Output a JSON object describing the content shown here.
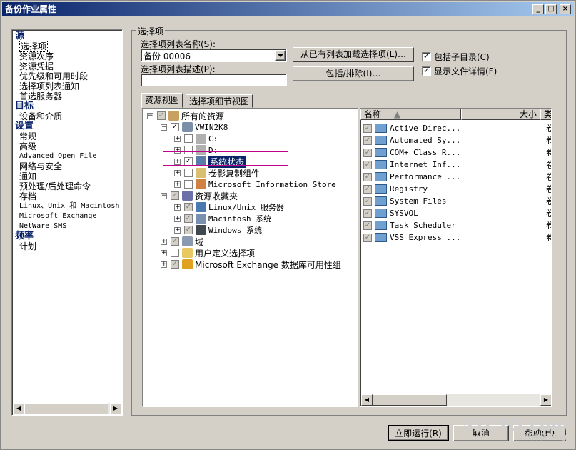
{
  "window": {
    "title": "备份作业属性",
    "controls": [
      "_",
      "□",
      "×"
    ]
  },
  "nav": {
    "items": [
      {
        "label": "源",
        "kind": "head"
      },
      {
        "label": "选择项",
        "kind": "item",
        "selected": true
      },
      {
        "label": "资源次序",
        "kind": "item"
      },
      {
        "label": "资源凭据",
        "kind": "item"
      },
      {
        "label": "优先级和可用时段",
        "kind": "item"
      },
      {
        "label": "选择项列表通知",
        "kind": "item"
      },
      {
        "label": "首选服务器",
        "kind": "item"
      },
      {
        "label": "目标",
        "kind": "head"
      },
      {
        "label": "设备和介质",
        "kind": "item"
      },
      {
        "label": "设置",
        "kind": "head"
      },
      {
        "label": "常规",
        "kind": "item"
      },
      {
        "label": "高级",
        "kind": "item"
      },
      {
        "label": "Advanced Open File",
        "kind": "item",
        "mono": true
      },
      {
        "label": "网络与安全",
        "kind": "item"
      },
      {
        "label": "通知",
        "kind": "item"
      },
      {
        "label": "预处理/后处理命令",
        "kind": "item"
      },
      {
        "label": "存档",
        "kind": "item"
      },
      {
        "label": "Linux、Unix 和 Macintosh",
        "kind": "item",
        "mono": true
      },
      {
        "label": "Microsoft Exchange",
        "kind": "item",
        "mono": true
      },
      {
        "label": "NetWare SMS",
        "kind": "item",
        "mono": true
      },
      {
        "label": "频率",
        "kind": "head"
      },
      {
        "label": "计划",
        "kind": "item"
      }
    ]
  },
  "selection": {
    "group_label": "选择项",
    "list_name_label": "选择项列表名称(S):",
    "list_name_value": "备份 00006",
    "list_desc_label": "选择项列表描述(P):",
    "list_desc_value": "",
    "load_button": "从已有列表加载选择项(L)…",
    "include_button": "包括/排除(I)…",
    "include_subdirs_label": "包括子目录(C)",
    "include_subdirs_checked": true,
    "show_details_label": "显示文件详情(F)",
    "show_details_checked": true
  },
  "tabs": [
    "资源视图",
    "选择项细节视图"
  ],
  "tree": {
    "all_resources": "所有的资源",
    "host": "VWIN2K8",
    "drive_c": "C:",
    "drive_d": "D:",
    "system_state": "系统状态",
    "shadow_copy": "卷影复制组件",
    "info_store": "Microsoft Information Store",
    "favorites": "资源收藏夹",
    "unix_servers": "Linux/Unix 服务器",
    "mac_systems": "Macintosh 系统",
    "windows_systems": "Windows 系统",
    "domains": "域",
    "user_defined": "用户定义选择项",
    "exchange_dag": "Microsoft Exchange 数据库可用性组"
  },
  "list": {
    "col_name": "名称",
    "col_size": "大小",
    "col_type": "类",
    "rows": [
      {
        "name": "Active Direc...",
        "type": "卷"
      },
      {
        "name": "Automated Sy...",
        "type": "卷"
      },
      {
        "name": "COM+ Class R...",
        "type": "卷"
      },
      {
        "name": "Internet Inf...",
        "type": "卷"
      },
      {
        "name": "Performance ...",
        "type": "卷"
      },
      {
        "name": "Registry",
        "type": "卷"
      },
      {
        "name": "System Files",
        "type": "卷"
      },
      {
        "name": "SYSVOL",
        "type": "卷"
      },
      {
        "name": "Task Scheduler",
        "type": "卷"
      },
      {
        "name": "VSS Express ...",
        "type": "卷"
      }
    ]
  },
  "footer": {
    "run_now": "立即运行(R)",
    "cancel": "取消",
    "help": "帮助(H)"
  },
  "watermark": {
    "main": "51CTO.com",
    "sub": "技术博客 Blog"
  }
}
